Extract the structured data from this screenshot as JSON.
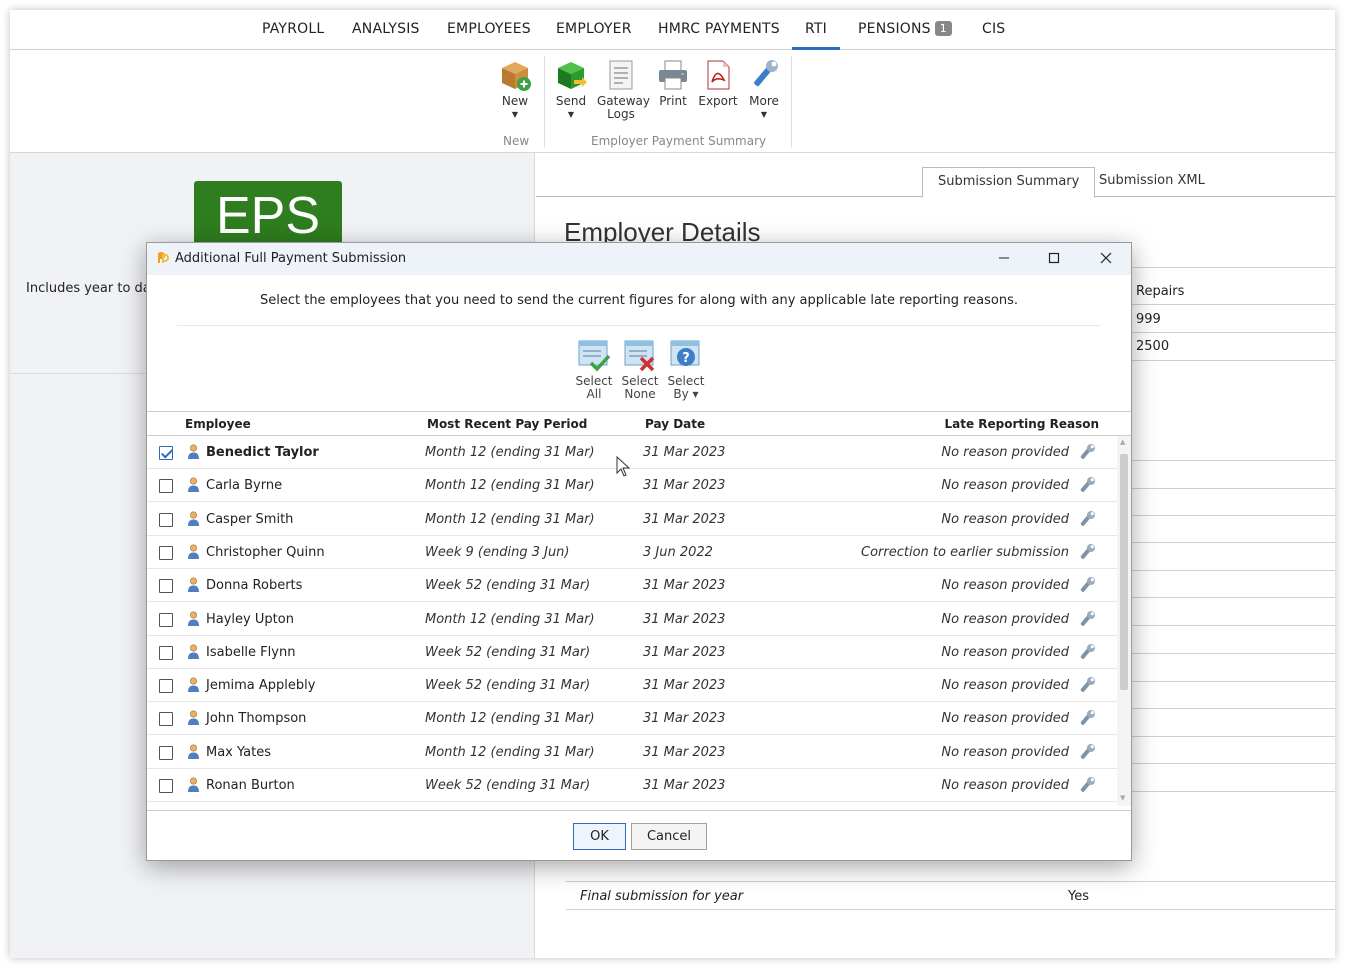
{
  "topnav": {
    "items": [
      "PAYROLL",
      "ANALYSIS",
      "EMPLOYEES",
      "EMPLOYER",
      "HMRC PAYMENTS",
      "RTI",
      "PENSIONS",
      "CIS"
    ],
    "active": "RTI",
    "pensions_badge": "1"
  },
  "ribbon": {
    "new_label": "New",
    "new_group": "New",
    "send_label": "Send",
    "gateway_label_1": "Gateway",
    "gateway_label_2": "Logs",
    "print_label": "Print",
    "export_label": "Export",
    "more_label": "More",
    "eps_group": "Employer Payment Summary"
  },
  "leftpane": {
    "logo_text": "EPS",
    "note": "Includes year to date"
  },
  "rightpane": {
    "tabs": [
      "Submission Summary",
      "Submission XML"
    ],
    "heading": "Employer Details",
    "peek_1": "Repairs",
    "peek_2": "999",
    "peek_3": "2500",
    "final_label": "Final submission for year",
    "final_value": "Yes"
  },
  "dialog": {
    "title": "Additional Full Payment Submission",
    "instruction": "Select the employees that you need to send the current figures for along with any applicable late reporting reasons.",
    "select_all_1": "Select",
    "select_all_2": "All",
    "select_none_1": "Select",
    "select_none_2": "None",
    "select_by_1": "Select",
    "select_by_2": "By ▾",
    "columns": {
      "employee": "Employee",
      "period": "Most Recent Pay Period",
      "date": "Pay Date",
      "reason": "Late Reporting Reason"
    },
    "rows": [
      {
        "name": "Benedict Taylor",
        "period": "Month 12 (ending 31 Mar)",
        "date": "31 Mar 2023",
        "reason": "No reason provided",
        "checked": true
      },
      {
        "name": "Carla Byrne",
        "period": "Month 12 (ending 31 Mar)",
        "date": "31 Mar 2023",
        "reason": "No reason provided",
        "checked": false
      },
      {
        "name": "Casper Smith",
        "period": "Month 12 (ending 31 Mar)",
        "date": "31 Mar 2023",
        "reason": "No reason provided",
        "checked": false
      },
      {
        "name": "Christopher Quinn",
        "period": "Week 9 (ending 3 Jun)",
        "date": "3 Jun 2022",
        "reason": "Correction to earlier submission",
        "checked": false
      },
      {
        "name": "Donna Roberts",
        "period": "Week 52 (ending 31 Mar)",
        "date": "31 Mar 2023",
        "reason": "No reason provided",
        "checked": false
      },
      {
        "name": "Hayley Upton",
        "period": "Month 12 (ending 31 Mar)",
        "date": "31 Mar 2023",
        "reason": "No reason provided",
        "checked": false
      },
      {
        "name": "Isabelle Flynn",
        "period": "Week 52 (ending 31 Mar)",
        "date": "31 Mar 2023",
        "reason": "No reason provided",
        "checked": false
      },
      {
        "name": "Jemima Applebly",
        "period": "Week 52 (ending 31 Mar)",
        "date": "31 Mar 2023",
        "reason": "No reason provided",
        "checked": false
      },
      {
        "name": "John Thompson",
        "period": "Month 12 (ending 31 Mar)",
        "date": "31 Mar 2023",
        "reason": "No reason provided",
        "checked": false
      },
      {
        "name": "Max Yates",
        "period": "Month 12 (ending 31 Mar)",
        "date": "31 Mar 2023",
        "reason": "No reason provided",
        "checked": false
      },
      {
        "name": "Ronan Burton",
        "period": "Week 52 (ending 31 Mar)",
        "date": "31 Mar 2023",
        "reason": "No reason provided",
        "checked": false
      }
    ],
    "ok_label": "OK",
    "cancel_label": "Cancel"
  },
  "icons": {
    "new": "package-add-icon",
    "send": "green-cube-send-icon",
    "gateway": "document-log-icon",
    "print": "printer-icon",
    "export": "pdf-icon",
    "more": "wrench-icon",
    "select_all": "select-all-icon",
    "select_none": "select-none-icon",
    "select_by": "select-by-icon",
    "row_person": "person-icon",
    "row_reason": "wrench-icon"
  },
  "colors": {
    "accent": "#2a6ebb",
    "eps_green": "#2e7d1e"
  }
}
